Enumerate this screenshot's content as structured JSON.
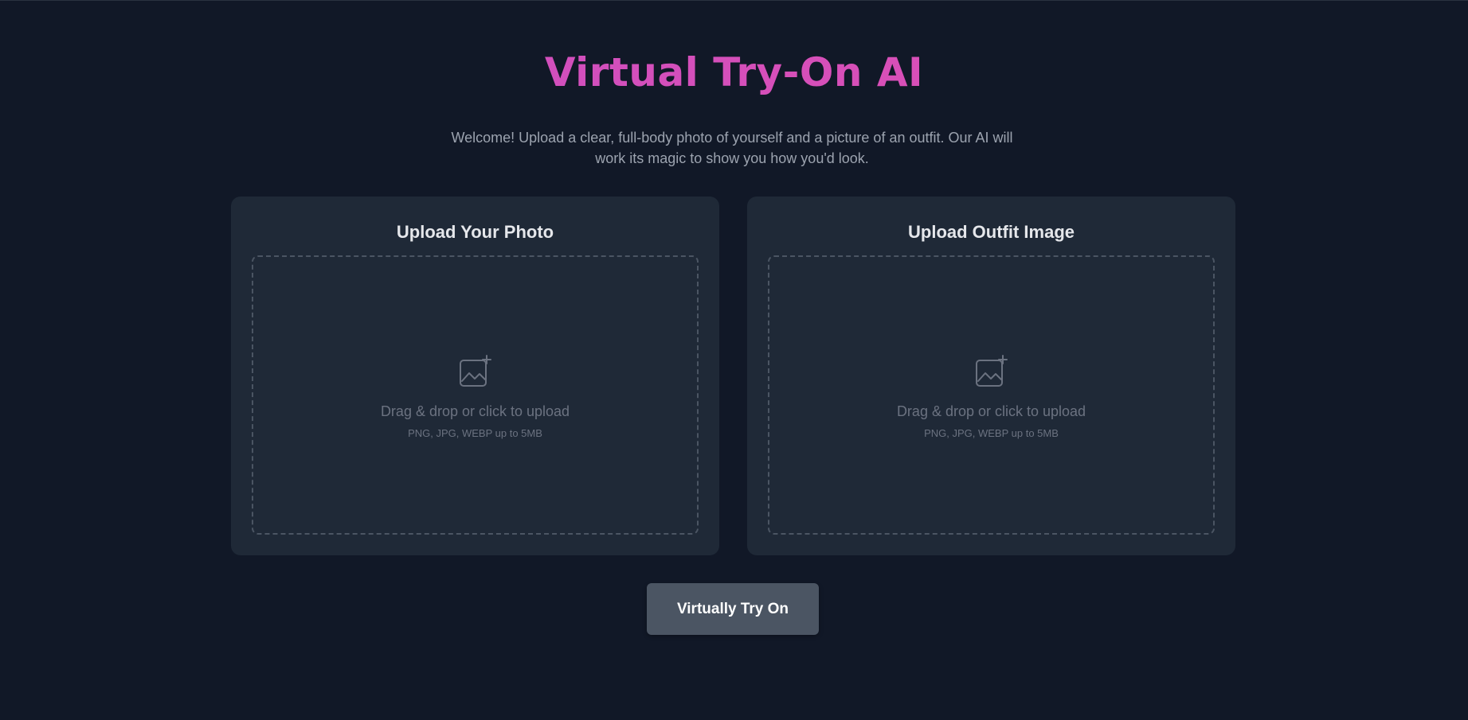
{
  "header": {
    "title": "Virtual Try-On AI",
    "subtitle": "Welcome! Upload a clear, full-body photo of yourself and a picture of an outfit. Our AI will work its magic to show you how you'd look."
  },
  "uploads": [
    {
      "title": "Upload Your Photo",
      "prompt": "Drag & drop or click to upload",
      "hint": "PNG, JPG, WEBP up to 5MB",
      "icon": "image-add-icon"
    },
    {
      "title": "Upload Outfit Image",
      "prompt": "Drag & drop or click to upload",
      "hint": "PNG, JPG, WEBP up to 5MB",
      "icon": "image-add-icon"
    }
  ],
  "actions": {
    "try_on_label": "Virtually Try On"
  },
  "colors": {
    "background": "#111827",
    "card": "#1f2937",
    "title_gradient_start": "#c84fc4",
    "title_gradient_end": "#e24fb0",
    "button": "#4b5563"
  }
}
